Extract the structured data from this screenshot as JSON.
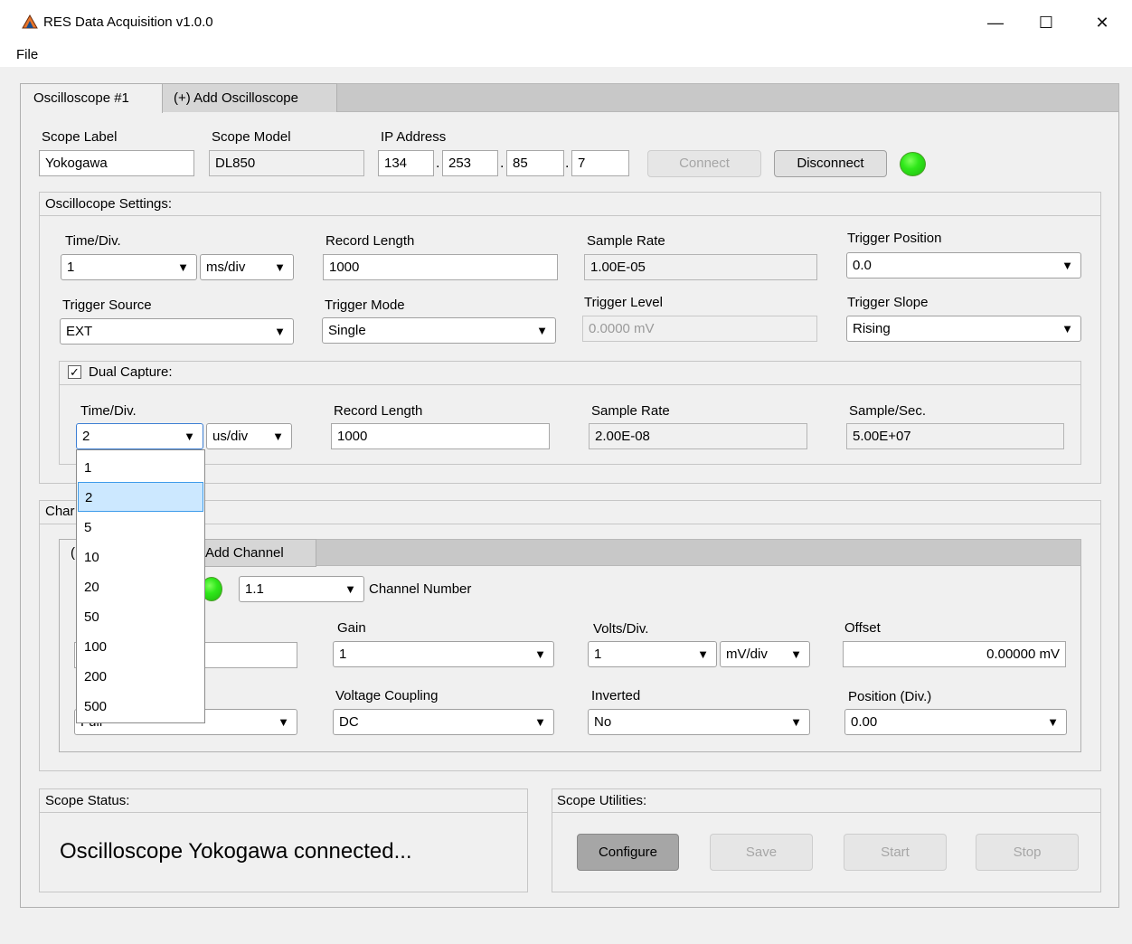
{
  "window": {
    "title": "RES Data Acquisition v1.0.0",
    "minimize": "—",
    "maximize": "☐",
    "close": "✕"
  },
  "menu": {
    "file": "File"
  },
  "tabs": [
    {
      "label": "Oscilloscope #1"
    },
    {
      "label": "(+) Add Oscilloscope"
    }
  ],
  "scope": {
    "label_caption": "Scope Label",
    "label_value": "Yokogawa",
    "model_caption": "Scope Model",
    "model_value": "DL850",
    "ip_caption": "IP Address",
    "ip": [
      "134",
      "253",
      "85",
      "7"
    ],
    "ip_sep": ".",
    "connect": "Connect",
    "disconnect": "Disconnect",
    "connected_color": "#2fe81a"
  },
  "settings": {
    "title": "Oscillocope Settings:",
    "time_div_label": "Time/Div.",
    "time_div_value": "1",
    "time_div_unit": "ms/div",
    "record_length_label": "Record Length",
    "record_length_value": "1000",
    "sample_rate_label": "Sample Rate",
    "sample_rate_value": "1.00E-05",
    "trigger_position_label": "Trigger Position",
    "trigger_position_value": "0.0",
    "trigger_source_label": "Trigger Source",
    "trigger_source_value": "EXT",
    "trigger_mode_label": "Trigger Mode",
    "trigger_mode_value": "Single",
    "trigger_level_label": "Trigger Level",
    "trigger_level_value": "0.0000 mV",
    "trigger_slope_label": "Trigger Slope",
    "trigger_slope_value": "Rising"
  },
  "dual": {
    "checkbox_mark": "✓",
    "checked": true,
    "title": "Dual Capture:",
    "time_div_label": "Time/Div.",
    "time_div_value": "2",
    "time_div_unit": "us/div",
    "record_length_label": "Record Length",
    "record_length_value": "1000",
    "sample_rate_label": "Sample Rate",
    "sample_rate_value": "2.00E-08",
    "sample_sec_label": "Sample/Sec.",
    "sample_sec_value": "5.00E+07",
    "dropdown_options": [
      "1",
      "2",
      "5",
      "10",
      "20",
      "50",
      "100",
      "200",
      "500"
    ],
    "dropdown_selected": "2"
  },
  "channel": {
    "title_partial": "Char",
    "tab_partial": "(",
    "add_channel": "Add Channel",
    "channel_number_value": "1.1",
    "channel_number_label": "Channel Number",
    "gain_label": "Gain",
    "gain_value": "1",
    "volts_div_label": "Volts/Div.",
    "volts_div_value": "1",
    "volts_div_unit": "mV/div",
    "offset_label": "Offset",
    "offset_value": "0.00000 mV",
    "voltage_coupling_label": "Voltage Coupling",
    "voltage_coupling_value": "DC",
    "inverted_label": "Inverted",
    "inverted_value": "No",
    "position_label": "Position (Div.)",
    "position_value": "0.00",
    "bandwidth_value_partial": "Full",
    "led_color": "#2fe81a"
  },
  "status": {
    "title": "Scope Status:",
    "message": "Oscilloscope Yokogawa connected..."
  },
  "utilities": {
    "title": "Scope Utilities:",
    "configure": "Configure",
    "save": "Save",
    "start": "Start",
    "stop": "Stop"
  },
  "arrow_glyph": "▼"
}
